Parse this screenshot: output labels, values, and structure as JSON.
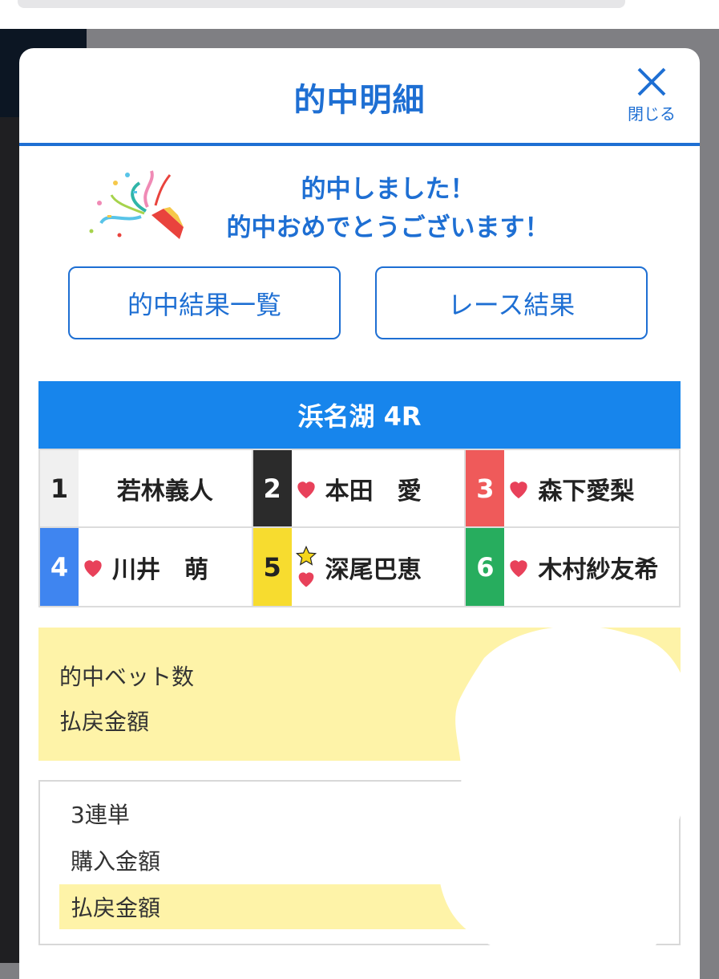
{
  "modal": {
    "title": "的中明細",
    "close_label": "閉じる"
  },
  "congrats": {
    "line1": "的中しました！",
    "line2": "的中おめでとうございます！"
  },
  "buttons": {
    "hit_results_list": "的中結果一覧",
    "race_results": "レース結果"
  },
  "race": {
    "title": "浜名湖 4R",
    "racers": [
      {
        "num": "1",
        "name": "若林義人",
        "color": "#f0f0f0",
        "num_color": "#222222",
        "heart": false,
        "star": false
      },
      {
        "num": "2",
        "name": "本田　愛",
        "color": "#2b2b2b",
        "num_color": "#ffffff",
        "heart": true,
        "star": false
      },
      {
        "num": "3",
        "name": "森下愛梨",
        "color": "#ef5a5a",
        "num_color": "#ffffff",
        "heart": true,
        "star": false
      },
      {
        "num": "4",
        "name": "川井　萌",
        "color": "#3f85f0",
        "num_color": "#ffffff",
        "heart": true,
        "star": false
      },
      {
        "num": "5",
        "name": "深尾巴恵",
        "color": "#f7dc2f",
        "num_color": "#222222",
        "heart": true,
        "star": true
      },
      {
        "num": "6",
        "name": "木村紗友希",
        "color": "#27ad5e",
        "num_color": "#ffffff",
        "heart": true,
        "star": false
      }
    ]
  },
  "summary": {
    "hit_bet_count_label": "的中ベット数",
    "payout_label": "払戻金額"
  },
  "detail": {
    "bet_type": "3連単",
    "purchase_label": "購入金額",
    "payout_label": "払戻金額"
  },
  "colors": {
    "accent": "#1e6fd3",
    "race_header": "#1785ec",
    "highlight": "#fef3a8",
    "heart": "#e8415a",
    "star": "#f5d61c"
  }
}
